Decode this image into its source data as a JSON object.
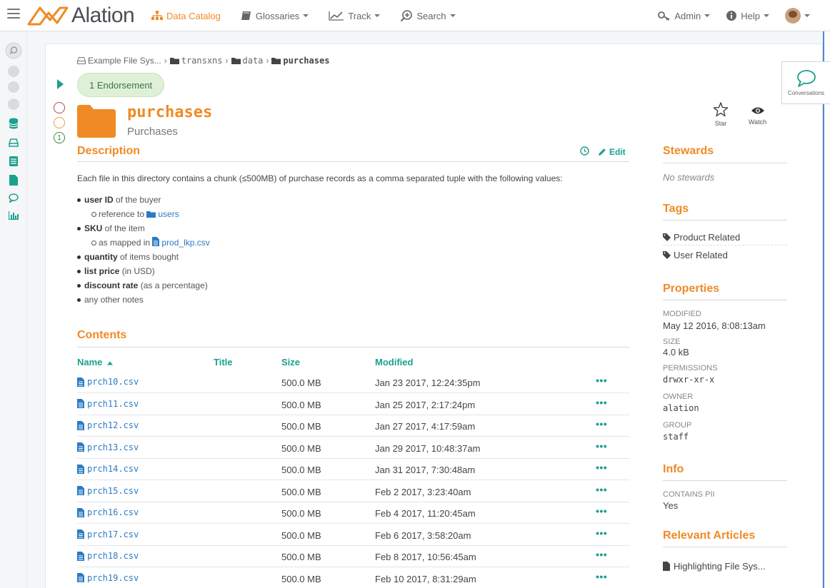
{
  "app": {
    "name": "Alation"
  },
  "nav": {
    "left": [
      {
        "label": "Data Catalog",
        "active": true,
        "dropdown": false
      },
      {
        "label": "Glossaries",
        "dropdown": true
      },
      {
        "label": "Track",
        "dropdown": true
      },
      {
        "label": "Search",
        "dropdown": true
      }
    ],
    "right": [
      {
        "label": "Admin",
        "dropdown": true
      },
      {
        "label": "Help",
        "dropdown": true
      }
    ]
  },
  "breadcrumb": [
    {
      "label": "Example File Sys...",
      "mono": false
    },
    {
      "label": "transxns",
      "mono": true
    },
    {
      "label": "data",
      "mono": true
    },
    {
      "label": "purchases",
      "mono": true,
      "current": true
    }
  ],
  "endorsement": {
    "label": "1 Endorsement"
  },
  "trust": {
    "count": "1"
  },
  "object": {
    "name": "purchases",
    "title": "Purchases"
  },
  "actions": {
    "star": "Star",
    "watch": "Watch",
    "conversations": "Conversations"
  },
  "description": {
    "heading": "Description",
    "edit_label": "Edit",
    "intro": "Each file in this directory contains a chunk (≤500MB) of purchase records as a comma separated tuple with the following values:",
    "items": [
      {
        "bold": "user ID",
        "rest": " of the buyer",
        "sub": {
          "text": "reference to ",
          "link": "users",
          "icon": "folder"
        }
      },
      {
        "bold": "SKU",
        "rest": " of the item",
        "sub": {
          "text": "as mapped in ",
          "link": "prod_lkp.csv",
          "icon": "file"
        }
      },
      {
        "bold": "quantity",
        "rest": " of items bought"
      },
      {
        "bold": "list price",
        "rest": " (in USD)"
      },
      {
        "bold": "discount rate",
        "rest": " (as a percentage)"
      },
      {
        "bold": "",
        "rest": "any other notes"
      }
    ]
  },
  "contents": {
    "heading": "Contents",
    "columns": {
      "name": "Name",
      "title": "Title",
      "size": "Size",
      "modified": "Modified"
    },
    "rows": [
      {
        "name": "prch10.csv",
        "size": "500.0 MB",
        "modified": "Jan 23 2017, 12:24:35pm"
      },
      {
        "name": "prch11.csv",
        "size": "500.0 MB",
        "modified": "Jan 25 2017, 2:17:24pm"
      },
      {
        "name": "prch12.csv",
        "size": "500.0 MB",
        "modified": "Jan 27 2017, 4:17:59am"
      },
      {
        "name": "prch13.csv",
        "size": "500.0 MB",
        "modified": "Jan 29 2017, 10:48:37am"
      },
      {
        "name": "prch14.csv",
        "size": "500.0 MB",
        "modified": "Jan 31 2017, 7:30:48am"
      },
      {
        "name": "prch15.csv",
        "size": "500.0 MB",
        "modified": "Feb 2 2017, 3:23:40am"
      },
      {
        "name": "prch16.csv",
        "size": "500.0 MB",
        "modified": "Feb 4 2017, 11:20:45am"
      },
      {
        "name": "prch17.csv",
        "size": "500.0 MB",
        "modified": "Feb 6 2017, 3:58:20am"
      },
      {
        "name": "prch18.csv",
        "size": "500.0 MB",
        "modified": "Feb 8 2017, 10:56:45am"
      },
      {
        "name": "prch19.csv",
        "size": "500.0 MB",
        "modified": "Feb 10 2017, 8:31:29am"
      }
    ],
    "more_label": "•••"
  },
  "sidebar": {
    "stewards": {
      "heading": "Stewards",
      "empty": "No stewards"
    },
    "tags": {
      "heading": "Tags",
      "items": [
        "Product Related",
        "User Related"
      ]
    },
    "properties": {
      "heading": "Properties",
      "items": [
        {
          "label": "MODIFIED",
          "value": "May 12 2016, 8:08:13am",
          "mono": false
        },
        {
          "label": "SIZE",
          "value": "4.0 kB",
          "mono": false
        },
        {
          "label": "PERMISSIONS",
          "value": "drwxr-xr-x",
          "mono": true
        },
        {
          "label": "OWNER",
          "value": "alation",
          "mono": true
        },
        {
          "label": "GROUP",
          "value": "staff",
          "mono": true
        }
      ]
    },
    "info": {
      "heading": "Info",
      "items": [
        {
          "label": "CONTAINS PII",
          "value": "Yes"
        }
      ]
    },
    "articles": {
      "heading": "Relevant Articles",
      "items": [
        "Highlighting File Sys..."
      ]
    }
  },
  "colors": {
    "brand_orange": "#f08a24",
    "teal": "#1aa08d",
    "link_blue": "#2b7bc4"
  }
}
